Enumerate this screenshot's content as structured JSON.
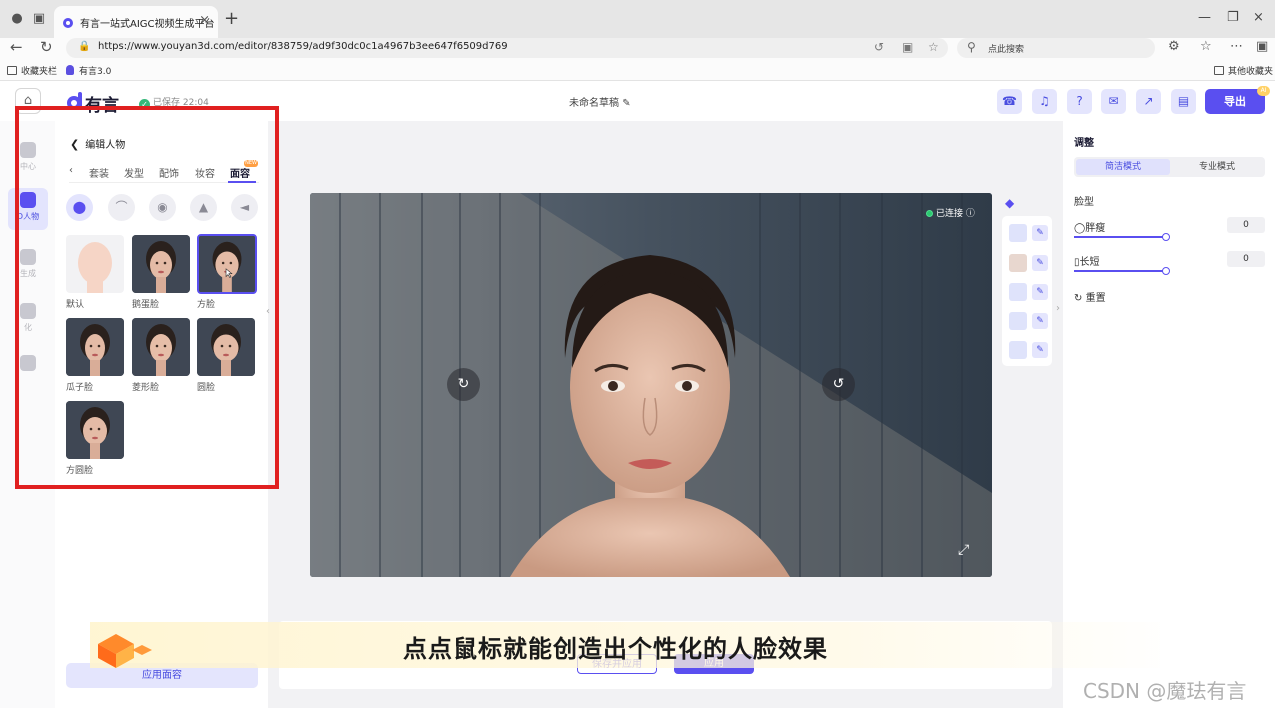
{
  "browser": {
    "tab_title": "有言一站式AIGC视频生成平台",
    "url": "https://www.youyan3d.com/editor/838759/ad9f30dc0c1a4967b3ee647f6509d769",
    "search_placeholder": "点此搜索",
    "bookmarks": [
      "收藏夹栏",
      "有言3.0"
    ],
    "other_bookmarks": "其他收藏夹"
  },
  "header": {
    "logo_text": "有言",
    "saved_status": "已保存 22:04",
    "draft_title": "未命名草稿",
    "export_label": "导出",
    "ai_badge": "AI"
  },
  "rail": {
    "items": [
      {
        "label": "中心",
        "active": false
      },
      {
        "label": "D人物",
        "active": true
      },
      {
        "label": "生成",
        "active": false
      },
      {
        "label": "化",
        "active": false
      },
      {
        "label": "",
        "active": false
      }
    ]
  },
  "panel": {
    "title": "编辑人物",
    "tabs": [
      "套装",
      "发型",
      "配饰",
      "妆容",
      "面容"
    ],
    "active_tab": "面容",
    "new_badge": "NEW",
    "features": [
      "face-shape",
      "eyebrow",
      "eye",
      "nose",
      "lips"
    ],
    "faces": [
      {
        "label": "默认"
      },
      {
        "label": "鹅蛋脸"
      },
      {
        "label": "方脸",
        "selected": true
      },
      {
        "label": "瓜子脸"
      },
      {
        "label": "菱形脸"
      },
      {
        "label": "圆脸"
      },
      {
        "label": "方圆脸"
      }
    ],
    "apply_label": "应用面容"
  },
  "stage": {
    "status": "已连接"
  },
  "right_panel": {
    "title": "调整",
    "modes": [
      "简洁模式",
      "专业模式"
    ],
    "active_mode": "简洁模式",
    "section": "脸型",
    "sliders": [
      {
        "label": "胖瘦",
        "value": "0"
      },
      {
        "label": "长短",
        "value": "0"
      }
    ],
    "reset_label": "重置"
  },
  "overlay": {
    "subtitle": "点点鼠标就能创造出个性化的人脸效果",
    "watermark": "CSDN @魔珐有言"
  },
  "bottom": {
    "secondary_label": "保存并应用",
    "primary_label": "应用"
  }
}
